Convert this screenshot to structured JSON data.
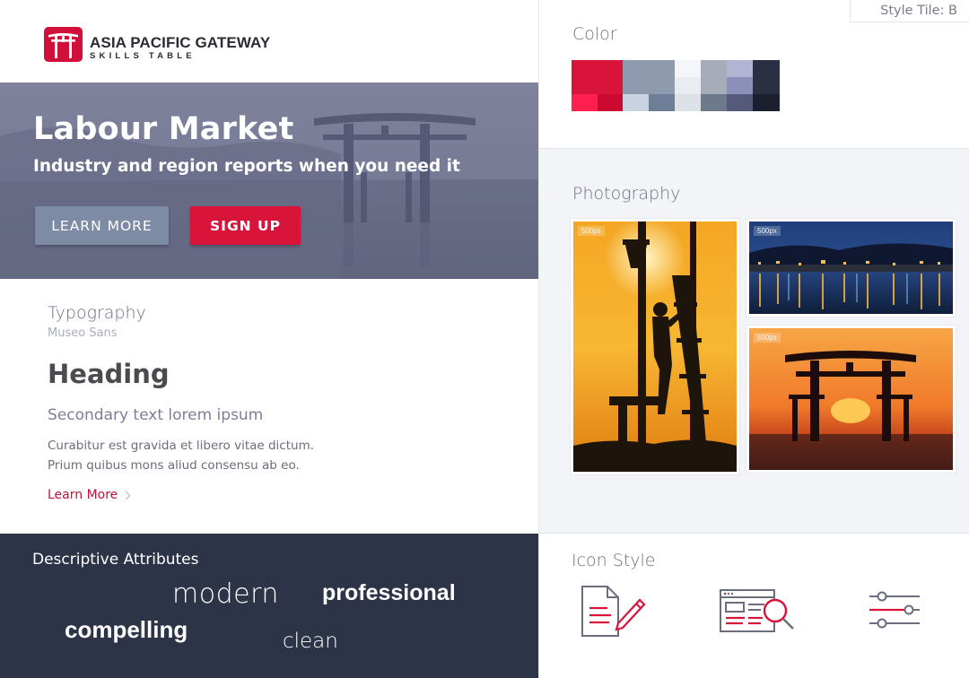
{
  "brand": {
    "name": "ASIA PACIFIC GATEWAY",
    "subtitle": "SKILLS TABLE",
    "logo_icon": "torii-gate-icon",
    "brand_color": "#d0103a"
  },
  "style_tile": "Style Tile: B",
  "hero": {
    "title": "Labour Market",
    "subtitle": "Industry and region reports when you need it",
    "learn_more": "LEARN MORE",
    "sign_up": "SIGN UP"
  },
  "typography": {
    "label": "Typography",
    "font_name": "Museo Sans",
    "heading": "Heading",
    "secondary": "Secondary text lorem ipsum",
    "body_line1": "Curabitur est gravida et libero vitae dictum.",
    "body_line2": "Prium quibus mons aliud  consensu ab eo.",
    "link": "Learn More"
  },
  "attributes": {
    "label": "Descriptive Attributes",
    "words": [
      "modern",
      "professional",
      "compelling",
      "clean"
    ]
  },
  "color": {
    "label": "Color",
    "swatches": [
      "#d8143b",
      "#ff1f4f",
      "#cc0a31",
      "#8e9aae",
      "#c8d2e0",
      "#6f7e98",
      "#f5f6f9",
      "#e9ecf1",
      "#dde1e8",
      "#a6acb8",
      "#6c7a8c",
      "#b2b4d4",
      "#8c8fb8",
      "#55597a",
      "#2b2f44",
      "#1c1f2e"
    ]
  },
  "photography": {
    "label": "Photography",
    "watermark": "500px",
    "photos": [
      "worker-silhouette-sunset",
      "harbour-at-night",
      "torii-gate-sunset"
    ]
  },
  "icon_style": {
    "label": "Icon Style",
    "icons": [
      "document-edit-icon",
      "browser-search-icon",
      "sliders-icon"
    ]
  }
}
